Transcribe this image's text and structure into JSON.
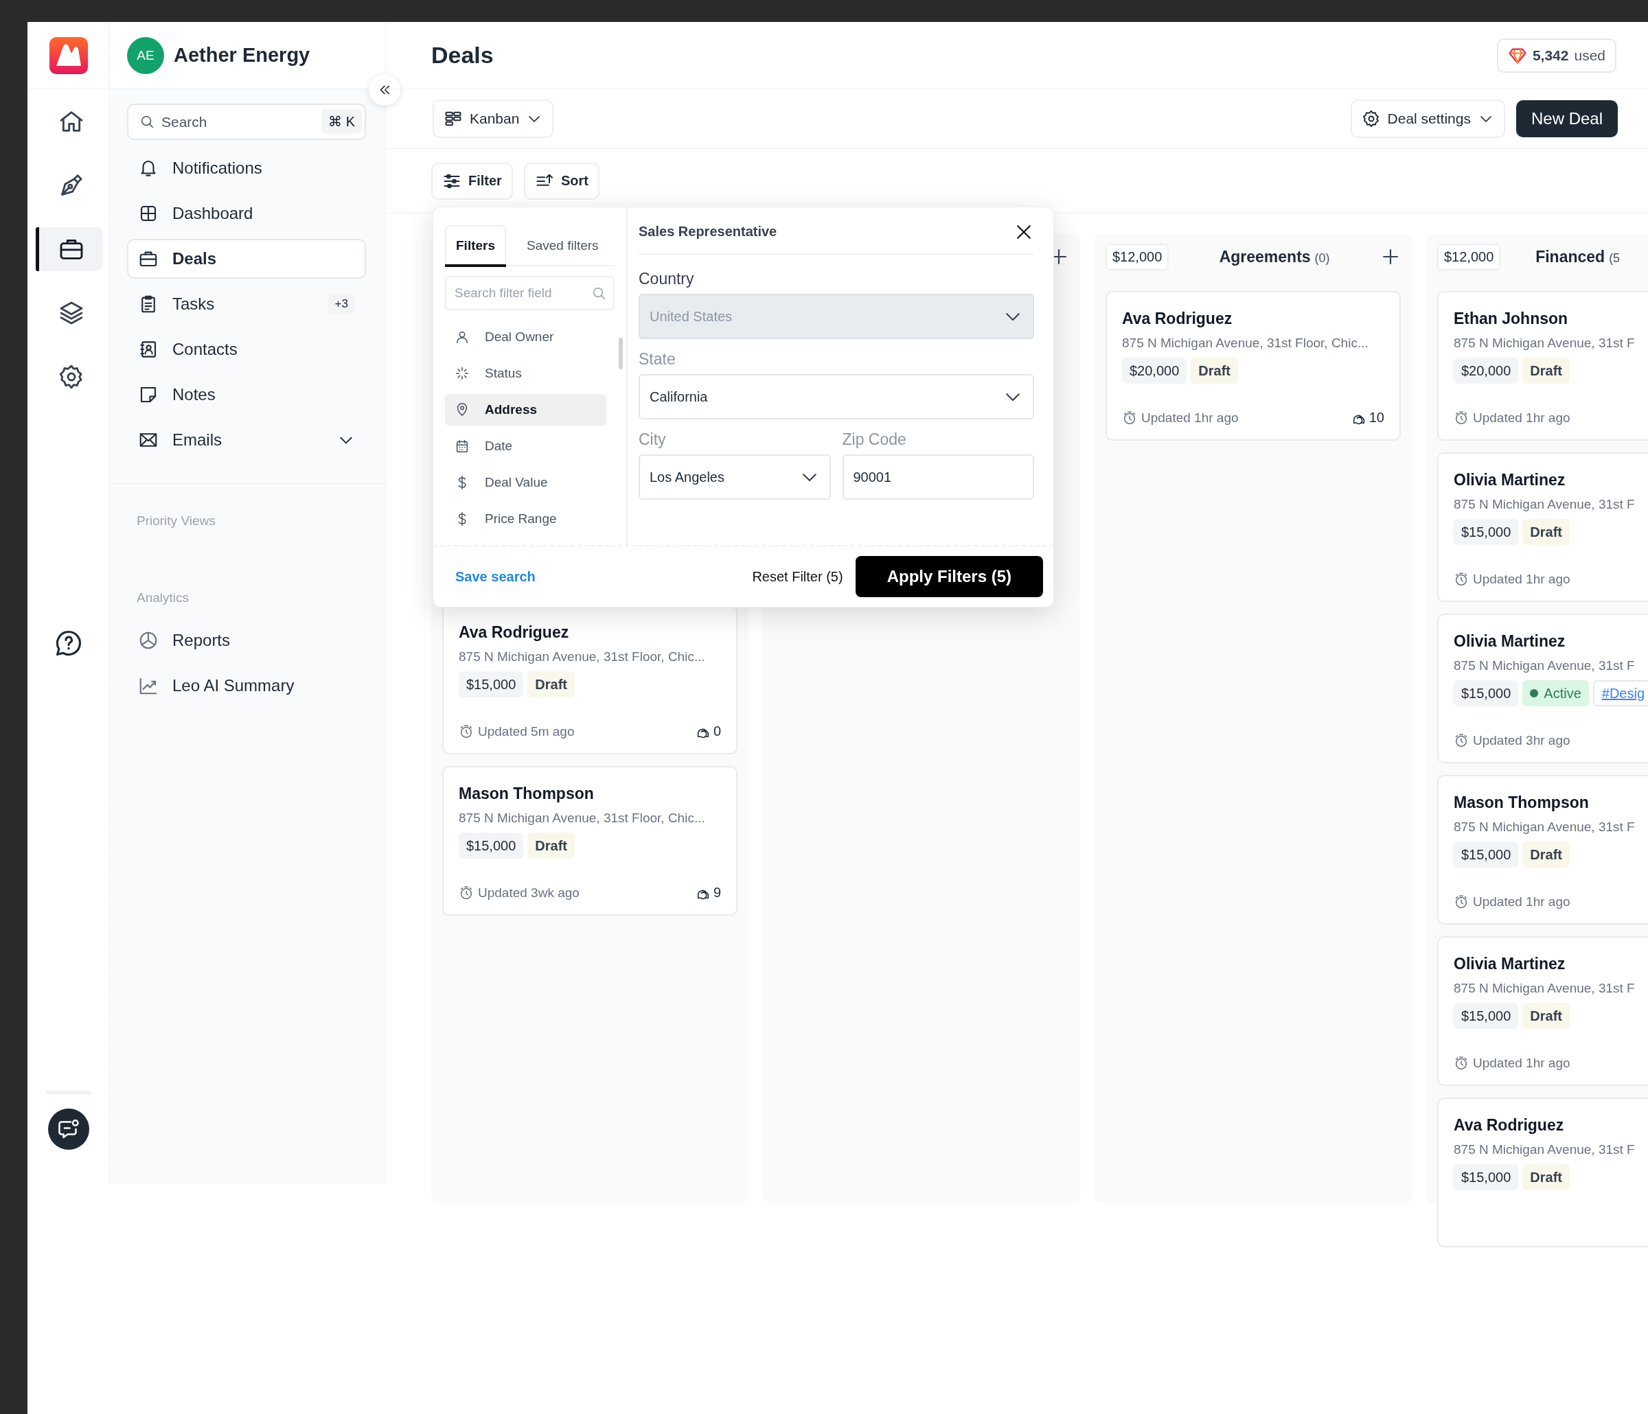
{
  "rail": {
    "items": [
      {
        "selected": false
      },
      {
        "selected": false
      },
      {
        "selected": true
      },
      {
        "selected": false
      },
      {
        "selected": false
      }
    ]
  },
  "workspace": {
    "initials": "AE",
    "name": "Aether Energy"
  },
  "search": {
    "placeholder": "Search",
    "shortcut": "⌘ K"
  },
  "nav": [
    {
      "label": "Notifications",
      "selected": false
    },
    {
      "label": "Dashboard",
      "selected": false
    },
    {
      "label": "Deals",
      "selected": true
    },
    {
      "label": "Tasks",
      "selected": false,
      "badge": "+3"
    },
    {
      "label": "Contacts",
      "selected": false
    },
    {
      "label": "Notes",
      "selected": false
    },
    {
      "label": "Emails",
      "selected": false,
      "expanded": false
    }
  ],
  "priority_views": {
    "title": "Priority Views"
  },
  "analytics": {
    "title": "Analytics",
    "items": [
      {
        "label": "Reports",
        "selected": false
      },
      {
        "label": "Leo AI Summary",
        "selected": false
      }
    ]
  },
  "page": {
    "title": "Deals",
    "usage": {
      "count": "5,342",
      "label": "used"
    }
  },
  "toolbar": {
    "view": "Kanban",
    "settings": "Deal settings",
    "new_button": "New Deal",
    "filter": "Filter",
    "sort": "Sort"
  },
  "board": {
    "columns": [
      {
        "cards": [
          {
            "name": "Ava Rodriguez",
            "address": "875 N Michigan Avenue, 31st Floor, Chic...",
            "tags": [
              {
                "kind": "value",
                "text": "$15,000"
              },
              {
                "kind": "draft",
                "text": "Draft"
              }
            ],
            "updated": "Updated 5m ago",
            "comments": "0"
          },
          {
            "name": "Mason Thompson",
            "address": "875 N Michigan Avenue, 31st Floor, Chic...",
            "tags": [
              {
                "kind": "value",
                "text": "$15,000"
              },
              {
                "kind": "draft",
                "text": "Draft"
              }
            ],
            "updated": "Updated 3wk ago",
            "comments": "9"
          }
        ]
      },
      {
        "addable": true
      },
      {
        "amount": "$12,000",
        "title": "Agreements",
        "count": "(0)",
        "addable": true,
        "cards": [
          {
            "name": "Ava Rodriguez",
            "address": "875 N Michigan Avenue, 31st Floor, Chic...",
            "tags": [
              {
                "kind": "value",
                "text": "$20,000"
              },
              {
                "kind": "draft",
                "text": "Draft"
              }
            ],
            "updated": "Updated 1hr ago",
            "comments": "10"
          }
        ]
      },
      {
        "amount": "$12,000",
        "title": "Financed",
        "count": "(5",
        "cards": [
          {
            "name": "Ethan Johnson",
            "address": "875 N Michigan Avenue, 31st F",
            "tags": [
              {
                "kind": "value",
                "text": "$20,000"
              },
              {
                "kind": "draft",
                "text": "Draft"
              }
            ],
            "updated": "Updated 1hr ago"
          },
          {
            "name": "Olivia Martinez",
            "address": "875 N Michigan Avenue, 31st F",
            "tags": [
              {
                "kind": "value",
                "text": "$15,000"
              },
              {
                "kind": "draft",
                "text": "Draft"
              }
            ],
            "updated": "Updated 1hr ago"
          },
          {
            "name": "Olivia Martinez",
            "address": "875 N Michigan Avenue, 31st F",
            "tags": [
              {
                "kind": "value",
                "text": "$15,000"
              },
              {
                "kind": "active",
                "text": "Active"
              },
              {
                "kind": "hashtag",
                "text": "#Desig"
              }
            ],
            "updated": "Updated 3hr ago"
          },
          {
            "name": "Mason Thompson",
            "address": "875 N Michigan Avenue, 31st F",
            "tags": [
              {
                "kind": "value",
                "text": "$15,000"
              },
              {
                "kind": "draft",
                "text": "Draft"
              }
            ],
            "updated": "Updated 1hr ago"
          },
          {
            "name": "Olivia Martinez",
            "address": "875 N Michigan Avenue, 31st F",
            "tags": [
              {
                "kind": "value",
                "text": "$15,000"
              },
              {
                "kind": "draft",
                "text": "Draft"
              }
            ],
            "updated": "Updated 1hr ago"
          },
          {
            "name": "Ava Rodriguez",
            "address": "875 N Michigan Avenue, 31st F",
            "tags": [
              {
                "kind": "value",
                "text": "$15,000"
              },
              {
                "kind": "draft",
                "text": "Draft"
              }
            ]
          }
        ]
      }
    ]
  },
  "filter_panel": {
    "tabs": [
      {
        "label": "Filters",
        "selected": true
      },
      {
        "label": "Saved filters",
        "selected": false
      }
    ],
    "search_placeholder": "Search filter field",
    "fields": [
      {
        "label": "Deal Owner",
        "selected": false
      },
      {
        "label": "Status",
        "selected": false
      },
      {
        "label": "Address",
        "selected": true
      },
      {
        "label": "Date",
        "selected": false
      },
      {
        "label": "Deal Value",
        "selected": false
      },
      {
        "label": "Price Range",
        "selected": false
      }
    ],
    "title": "Sales Representative",
    "inputs": [
      {
        "label": "Country",
        "value": "United States",
        "kind": "select",
        "disabled": true
      },
      {
        "label": "State",
        "value": "California",
        "kind": "select",
        "disabled": false
      },
      {
        "label": "City",
        "value": "Los Angeles",
        "kind": "select",
        "disabled": false
      },
      {
        "label": "Zip Code",
        "value": "90001",
        "kind": "text",
        "disabled": false
      }
    ],
    "save": "Save search",
    "reset": "Reset Filter (5)",
    "apply": "Apply Filters (5)"
  }
}
